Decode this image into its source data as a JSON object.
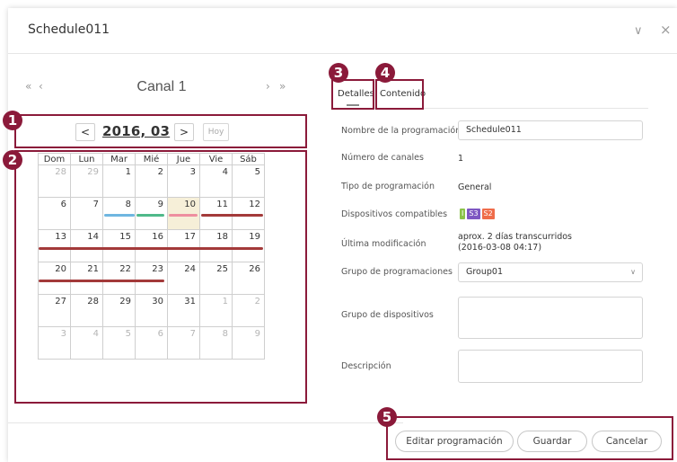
{
  "window": {
    "title": "Schedule011",
    "minimize_glyph": "∨",
    "close_glyph": "×"
  },
  "channel_nav": {
    "first": "«",
    "prev": "‹",
    "name": "Canal 1",
    "next": "›",
    "last": "»"
  },
  "month_nav": {
    "prev": "<",
    "label": "2016, 03",
    "next": ">",
    "today": "Hoy"
  },
  "calendar": {
    "weekdays": [
      "Dom",
      "Lun",
      "Mar",
      "Mié",
      "Jue",
      "Vie",
      "Sáb"
    ],
    "weeks": [
      [
        "28",
        "29",
        "1",
        "2",
        "3",
        "4",
        "5"
      ],
      [
        "6",
        "7",
        "8",
        "9",
        "10",
        "11",
        "12"
      ],
      [
        "13",
        "14",
        "15",
        "16",
        "17",
        "18",
        "19"
      ],
      [
        "20",
        "21",
        "22",
        "23",
        "24",
        "25",
        "26"
      ],
      [
        "27",
        "28",
        "29",
        "30",
        "31",
        "1",
        "2"
      ],
      [
        "3",
        "4",
        "5",
        "6",
        "7",
        "8",
        "9"
      ]
    ],
    "today": "10",
    "event_colors": {
      "blue": "#6fb6e0",
      "green": "#4fb98a",
      "pink": "#ee8fa0",
      "darkred": "#a33a3a"
    }
  },
  "tabs": {
    "details": "Detalles",
    "content": "Contenido"
  },
  "details": {
    "name_label": "Nombre de la programación",
    "name_value": "Schedule011",
    "channels_label": "Número de canales",
    "channels_value": "1",
    "type_label": "Tipo de programación",
    "type_value": "General",
    "devices_label": "Dispositivos compatibles",
    "devices_chips": [
      "I",
      "S3",
      "S2"
    ],
    "modified_label": "Última modificación",
    "modified_value_1": "aprox. 2 días transcurridos",
    "modified_value_2": "(2016-03-08 04:17)",
    "group_label": "Grupo de programaciones",
    "group_value": "Group01",
    "device_group_label": "Grupo de dispositivos",
    "description_label": "Descripción"
  },
  "chip_colors": [
    "#8bc34a",
    "#7e57c2",
    "#ef6c4a"
  ],
  "buttons": {
    "edit": "Editar programación",
    "save": "Guardar",
    "cancel": "Cancelar"
  },
  "annotations": [
    "1",
    "2",
    "3",
    "4",
    "5"
  ],
  "annotation_color": "#8b1a3a"
}
